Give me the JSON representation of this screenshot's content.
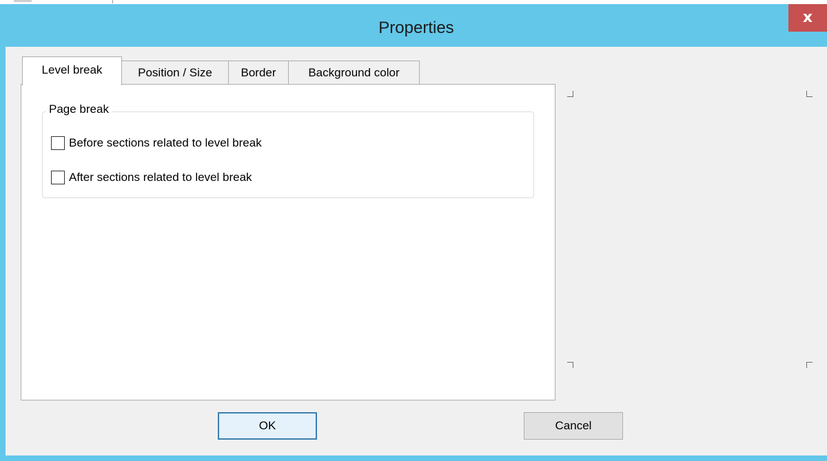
{
  "window": {
    "title": "Properties",
    "close_label": "x"
  },
  "tabs": [
    {
      "label": "Level break",
      "active": true
    },
    {
      "label": "Position / Size",
      "active": false
    },
    {
      "label": "Border",
      "active": false
    },
    {
      "label": "Background color",
      "active": false
    }
  ],
  "page_break": {
    "legend": "Page break",
    "options": [
      {
        "label": "Before sections related to level break",
        "checked": false
      },
      {
        "label": "After sections related to level break",
        "checked": false
      }
    ]
  },
  "buttons": {
    "ok_label": "OK",
    "cancel_label": "Cancel"
  },
  "colors": {
    "title_bar": "#63c7e9",
    "close_button": "#c75050",
    "client_background": "#f0f0f0"
  }
}
